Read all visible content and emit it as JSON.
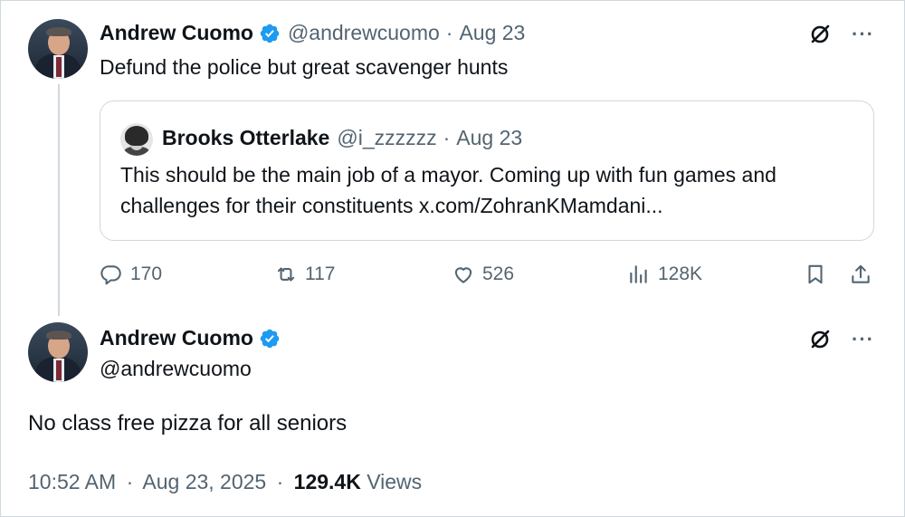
{
  "parent": {
    "author_name": "Andrew Cuomo",
    "handle": "@andrewcuomo",
    "separator": "·",
    "date": "Aug 23",
    "text": "Defund the police but great scavenger hunts",
    "quote": {
      "author_name": "Brooks Otterlake",
      "handle": "@i_zzzzzz",
      "separator": "·",
      "date": "Aug 23",
      "line1": "This should be the main job of a mayor. Coming up with fun games and",
      "line2": "challenges for their constituents x.com/ZohranKMamdani..."
    },
    "actions": {
      "replies": "170",
      "reposts": "117",
      "likes": "526",
      "views": "128K"
    }
  },
  "main": {
    "author_name": "Andrew Cuomo",
    "handle": "@andrewcuomo",
    "text": "No class free pizza for all seniors",
    "time": "10:52 AM",
    "separator": "·",
    "date": "Aug 23, 2025",
    "separator2": "·",
    "views_count": "129.4K",
    "views_label": "Views"
  },
  "icons": {
    "more": "···",
    "verified_color": "#1d9bf0",
    "muted_color": "#536471"
  }
}
